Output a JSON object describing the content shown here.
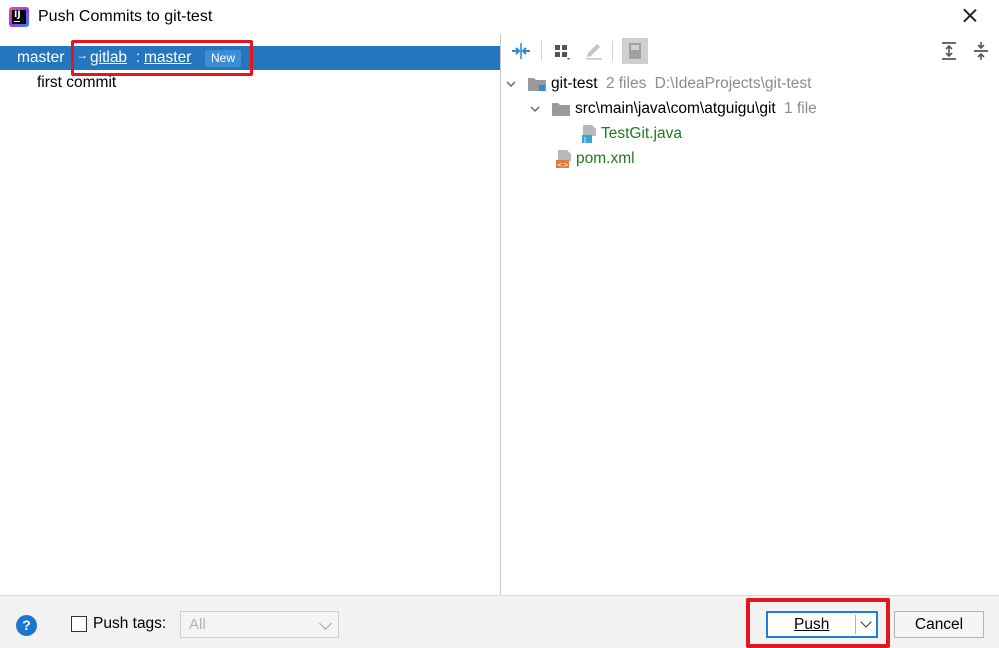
{
  "window": {
    "title": "Push Commits to git-test",
    "app_icon_text": "IJ"
  },
  "branch": {
    "local": "master",
    "arrow": "→",
    "remote": "gitlab",
    "separator": ":",
    "target": "master",
    "badge": "New"
  },
  "commits": [
    {
      "message": "first commit"
    }
  ],
  "toolbar": {
    "icons": [
      "merge-arrows-icon",
      "group-by-icon",
      "edit-icon",
      "preview-icon",
      "expand-all-icon",
      "collapse-all-icon"
    ]
  },
  "tree": {
    "root": {
      "label": "git-test",
      "count": "2 files",
      "path": "D:\\IdeaProjects\\git-test"
    },
    "folder": {
      "label": "src\\main\\java\\com\\atguigu\\git",
      "count": "1 file"
    },
    "files": [
      {
        "label": "TestGit.java"
      },
      {
        "label": "pom.xml"
      }
    ]
  },
  "footer": {
    "help_label": "?",
    "push_tags_label": "Push tags:",
    "tags_select_value": "All",
    "push_label": "Push",
    "cancel_label": "Cancel"
  },
  "colors": {
    "selection": "#2675bf",
    "highlight_box": "#e3151f",
    "file_added": "#1e7b1e",
    "primary_button_border": "#1c7ed6"
  }
}
